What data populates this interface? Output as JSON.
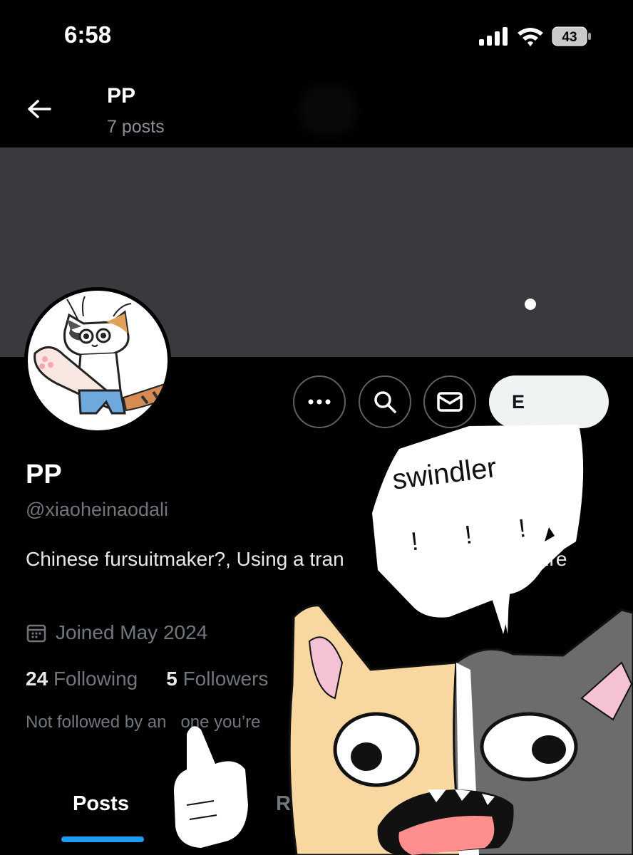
{
  "status_bar": {
    "time": "6:58",
    "battery": "43"
  },
  "header": {
    "name": "PP",
    "posts": "7 posts"
  },
  "actions": {
    "edit_label": "E"
  },
  "profile": {
    "name": "PP",
    "handle": "@xiaoheinaodali",
    "bio": "Chinese fursuitmaker?, Using a tran                     sion closure",
    "joined": "Joined May 2024",
    "following_count": "24",
    "following_label": "Following",
    "followers_count": "5",
    "followers_label": "Followers",
    "not_followed": "Not followed by an   one you’re"
  },
  "tabs": {
    "posts": "Posts",
    "replies": "Re"
  },
  "sticker": {
    "text": "swindler",
    "exclaim": "! ! !"
  },
  "colors": {
    "accent": "#1d9bf0",
    "banner": "#383a3d",
    "muted": "#71767b"
  }
}
